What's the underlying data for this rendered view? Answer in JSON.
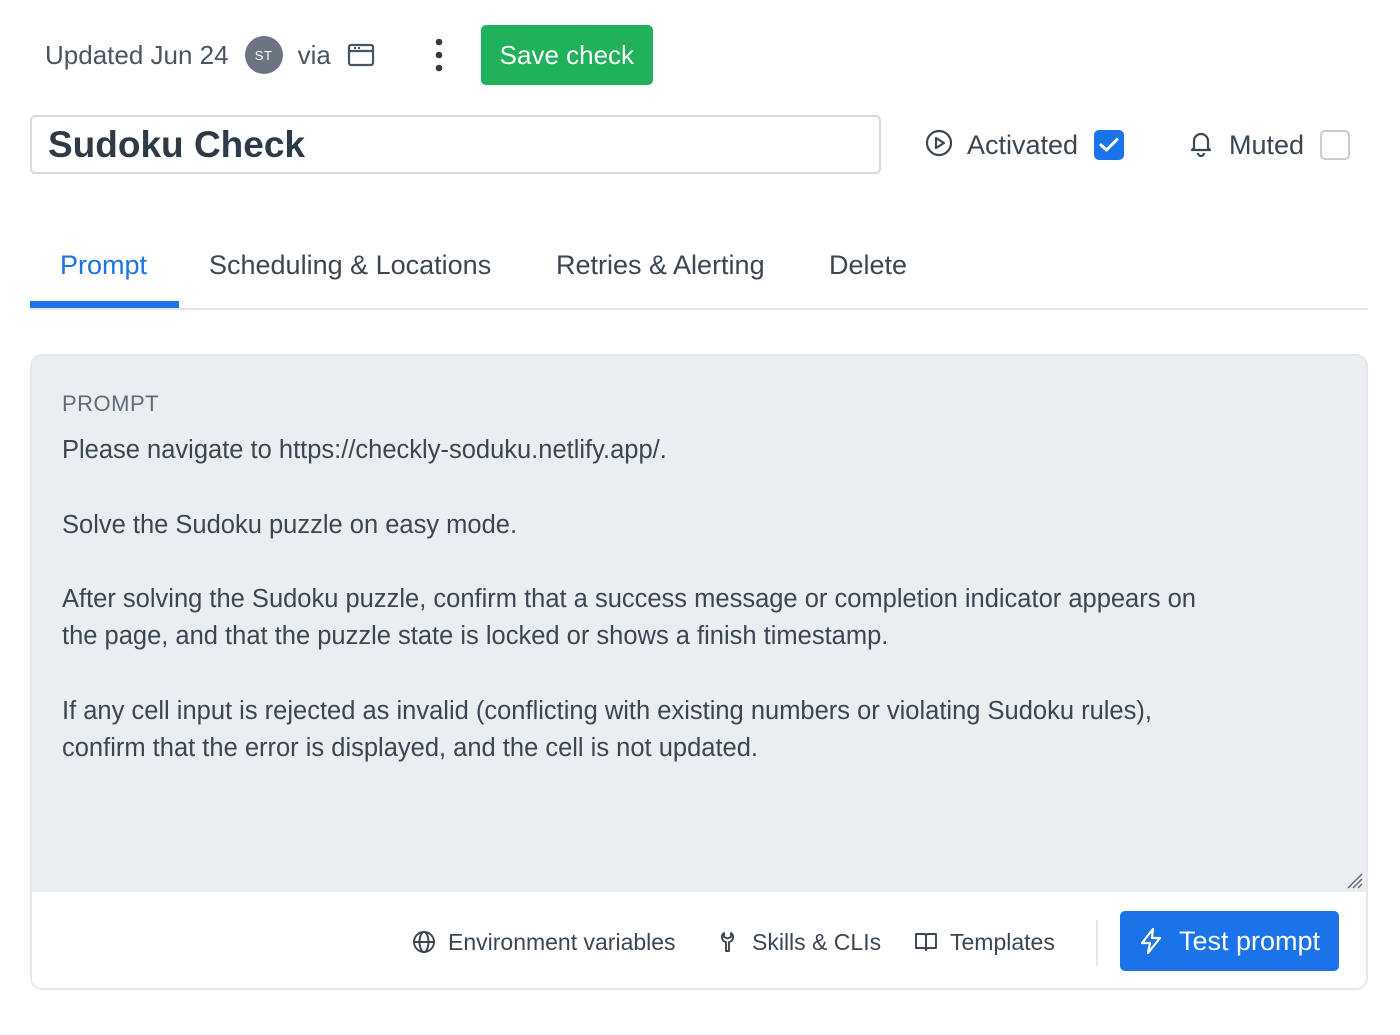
{
  "header": {
    "updated_text": "Updated Jun 24",
    "avatar_initials": "ST",
    "via_text": "via",
    "via_icon": "browser-window-icon",
    "more_icon": "kebab-menu-icon",
    "save_label": "Save check"
  },
  "check": {
    "name": "Sudoku Check",
    "activated_label": "Activated",
    "activated_checked": true,
    "muted_label": "Muted",
    "muted_checked": false
  },
  "tabs": [
    {
      "label": "Prompt",
      "active": true
    },
    {
      "label": "Scheduling & Locations",
      "active": false
    },
    {
      "label": "Retries & Alerting",
      "active": false
    },
    {
      "label": "Delete",
      "active": false
    }
  ],
  "prompt": {
    "title": "PROMPT",
    "lines": [
      "Please navigate to https://checkly-soduku.netlify.app/.",
      "",
      "Solve the Sudoku puzzle on easy mode.",
      "",
      "After solving the Sudoku puzzle, confirm that a success message or completion indicator appears on",
      "the page, and that the puzzle state is locked or shows a finish timestamp.",
      "",
      "If any cell input is rejected as invalid (conflicting with existing numbers or violating Sudoku rules),",
      "confirm that the error is displayed, and the cell is not updated."
    ]
  },
  "footer": {
    "env_label": "Environment variables",
    "skills_label": "Skills & CLIs",
    "templates_label": "Templates",
    "test_label": "Test prompt"
  },
  "colors": {
    "accent": "#1a73e8",
    "save_green": "#21b15a",
    "panel_bg": "#ebeef1"
  }
}
